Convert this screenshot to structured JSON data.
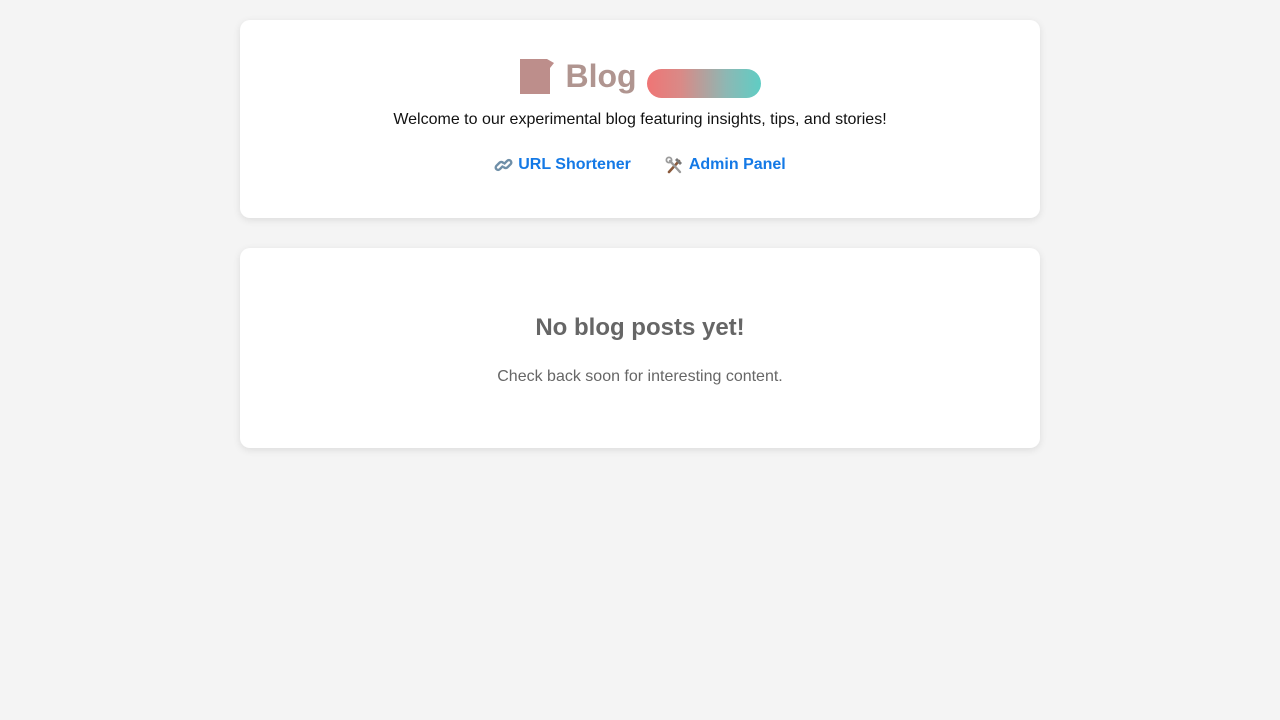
{
  "header": {
    "icon": "memo-icon",
    "title": "Blog",
    "badge_colors": [
      "#ef7575",
      "#5fcdc4"
    ],
    "welcome": "Welcome to our experimental blog featuring insights, tips, and stories!"
  },
  "nav": {
    "links": [
      {
        "icon": "link-icon",
        "label": "URL Shortener"
      },
      {
        "icon": "tools-icon",
        "label": "Admin Panel"
      }
    ],
    "link_color": "#1479e6"
  },
  "posts": {
    "empty_title": "No blog posts yet!",
    "empty_message": "Check back soon for interesting content."
  }
}
